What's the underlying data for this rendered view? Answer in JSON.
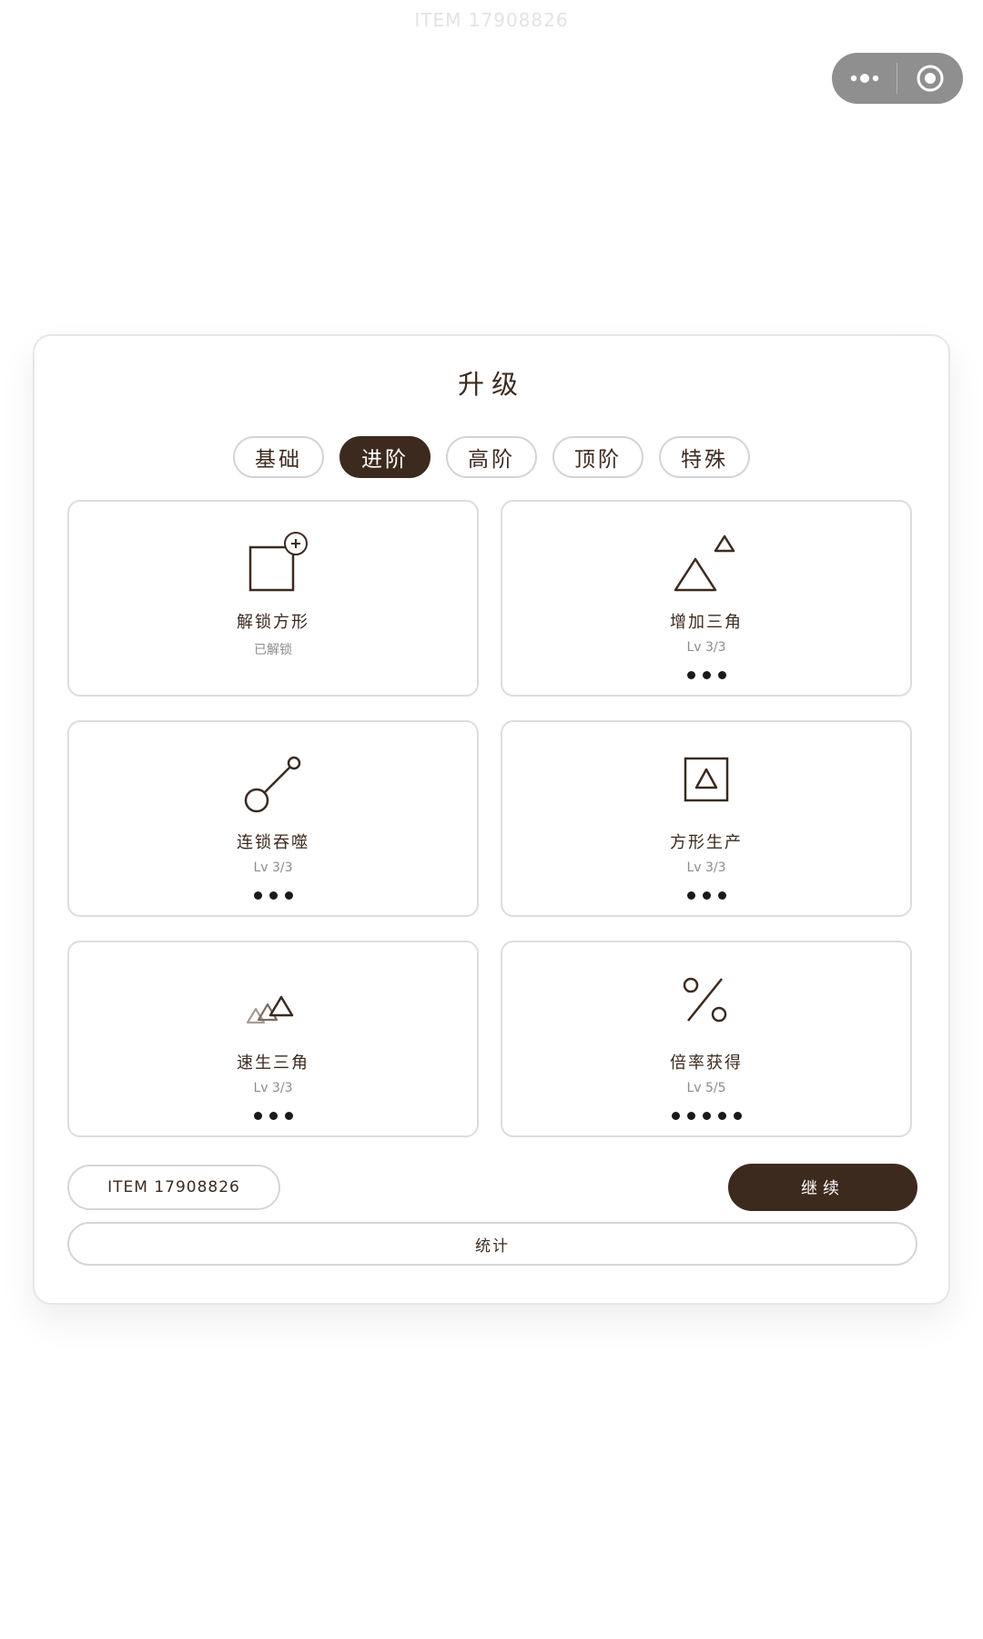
{
  "header": {
    "item_id": "ITEM 17908826"
  },
  "capsule": {
    "more_icon": "more-dots-icon",
    "close_icon": "target-close-icon"
  },
  "panel": {
    "title": "升级",
    "tabs": [
      {
        "label": "基础",
        "active": false
      },
      {
        "label": "进阶",
        "active": true
      },
      {
        "label": "高阶",
        "active": false
      },
      {
        "label": "顶阶",
        "active": false
      },
      {
        "label": "特殊",
        "active": false
      }
    ],
    "cards": [
      {
        "name": "解锁方形",
        "status": "已解锁",
        "icon": "square-plus-icon",
        "level_dots": 0
      },
      {
        "name": "增加三角",
        "status": "Lv 3/3",
        "icon": "two-triangles-icon",
        "level_dots": 3
      },
      {
        "name": "连锁吞噬",
        "status": "Lv 3/3",
        "icon": "chain-link-icon",
        "level_dots": 3
      },
      {
        "name": "方形生产",
        "status": "Lv 3/3",
        "icon": "square-triangle-icon",
        "level_dots": 3
      },
      {
        "name": "速生三角",
        "status": "Lv 3/3",
        "icon": "triple-triangles-icon",
        "level_dots": 3
      },
      {
        "name": "倍率获得",
        "status": "Lv 5/5",
        "icon": "percent-icon",
        "level_dots": 5
      }
    ],
    "seed_label": "ITEM 17908826",
    "continue_label": "继续",
    "stats_label": "统计"
  },
  "colors": {
    "accent": "#3d2a1e",
    "border": "#dddddd",
    "muted": "#8c8c8c"
  }
}
